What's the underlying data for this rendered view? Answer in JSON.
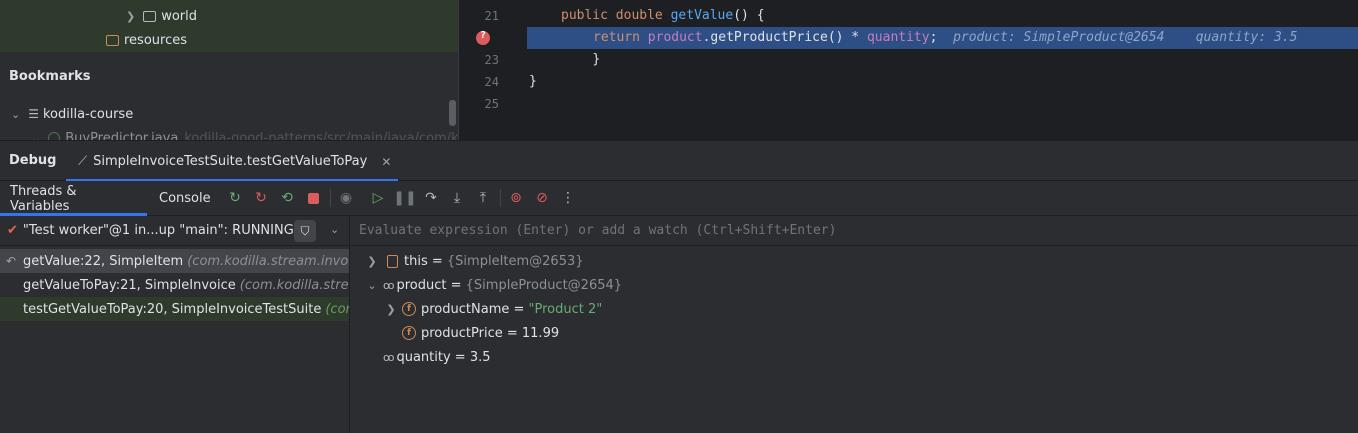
{
  "project": {
    "tree": [
      {
        "label": "world",
        "icon": "folder-icon"
      },
      {
        "label": "resources",
        "icon": "resources-folder-icon"
      }
    ],
    "bookmarks_title": "Bookmarks",
    "bookmarks": [
      {
        "label": "kodilla-course"
      },
      {
        "label": "BuyPredictor.java",
        "path": "kodilla-good-patterns/src/main/java/com/ko"
      }
    ]
  },
  "editor": {
    "lines": [
      {
        "num": "21"
      },
      {
        "num": "22"
      },
      {
        "num": "23"
      },
      {
        "num": "24"
      },
      {
        "num": "25"
      }
    ],
    "code": {
      "l21_kw1": "public",
      "l21_kw2": "double",
      "l21_fn": "getValue",
      "l21_rest": "() {",
      "l22_kw": "return",
      "l22_fld1": "product",
      "l22_mid": ".getProductPrice() * ",
      "l22_fld2": "quantity",
      "l22_end": ";",
      "l22_inline1": "product: SimpleProduct@2654",
      "l22_inline2": "quantity: 3.5",
      "l23": "}",
      "l24": "}"
    }
  },
  "debug": {
    "title": "Debug",
    "session_tab": "SimpleInvoiceTestSuite.testGetValueToPay",
    "tabs": [
      "Threads & Variables",
      "Console"
    ]
  },
  "frames": {
    "thread": "\"Test worker\"@1 in...up \"main\": RUNNING",
    "items": [
      {
        "method": "getValue:22, SimpleItem",
        "pkg": "(com.kodilla.stream.invoice."
      },
      {
        "method": "getValueToPay:21, SimpleInvoice",
        "pkg": "(com.kodilla.stream"
      },
      {
        "method": "testGetValueToPay:20, SimpleInvoiceTestSuite",
        "pkg": "(com"
      }
    ]
  },
  "variables": {
    "eval_placeholder": "Evaluate expression (Enter) or add a watch (Ctrl+Shift+Enter)",
    "this_name": "this",
    "this_value": "{SimpleItem@2653}",
    "product_name": "product",
    "product_value": "{SimpleProduct@2654}",
    "productName_name": "productName",
    "productName_value": "\"Product 2\"",
    "productPrice_name": "productPrice",
    "productPrice_value": "11.99",
    "quantity_name": "quantity",
    "quantity_value": "3.5",
    "equals": " = "
  },
  "colors": {
    "accent": "#3574f0",
    "highlight": "#2d4f85",
    "breakpoint": "#db5c5c",
    "string": "#6aab73"
  }
}
